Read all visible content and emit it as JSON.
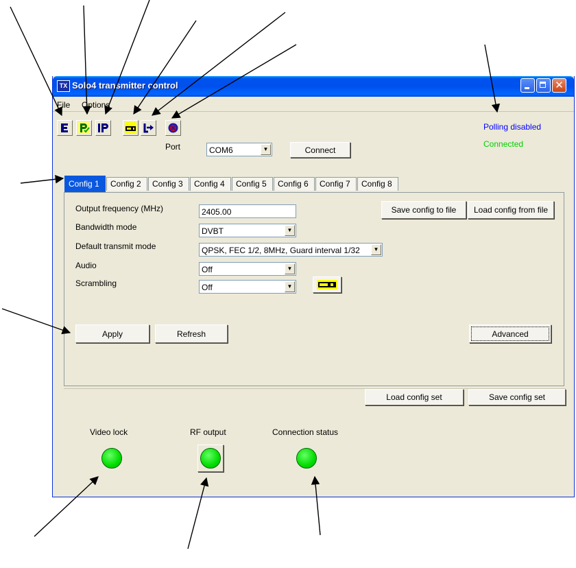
{
  "window": {
    "title": "Solo4 transmitter control",
    "logo_text": "TX"
  },
  "menu": {
    "file": "File",
    "options": "Options"
  },
  "toolbar": {
    "icons": [
      "e-icon",
      "p-check-icon",
      "p-bars-icon",
      "key-icon",
      "export-arrow-icon",
      "stop-icon"
    ]
  },
  "status": {
    "polling": "Polling disabled",
    "connected": "Connected",
    "polling_color": "#0000ff",
    "connected_color": "#00d000"
  },
  "port": {
    "label": "Port",
    "value": "COM6",
    "connect_label": "Connect"
  },
  "tabs": [
    "Config 1",
    "Config 2",
    "Config 3",
    "Config 4",
    "Config 5",
    "Config 6",
    "Config 7",
    "Config 8"
  ],
  "active_tab": "Config 1",
  "config": {
    "output_frequency_label": "Output frequency (MHz)",
    "output_frequency_value": "2405.00",
    "bandwidth_label": "Bandwidth mode",
    "bandwidth_value": "DVBT",
    "transmit_mode_label": "Default transmit mode",
    "transmit_mode_value": "QPSK, FEC 1/2, 8MHz, Guard interval 1/32",
    "audio_label": "Audio",
    "audio_value": "Off",
    "scrambling_label": "Scrambling",
    "scrambling_value": "Off",
    "save_file_label": "Save config to file",
    "load_file_label": "Load config from file",
    "apply_label": "Apply",
    "refresh_label": "Refresh",
    "advanced_label": "Advanced"
  },
  "config_set": {
    "load_label": "Load config set",
    "save_label": "Save config set"
  },
  "indicators": {
    "video_lock": "Video lock",
    "rf_output": "RF output",
    "connection_status": "Connection status",
    "led_color": "#00dd00"
  },
  "accent": {
    "titlebar": "#0053ee",
    "active_tab": "#0a58e0"
  }
}
